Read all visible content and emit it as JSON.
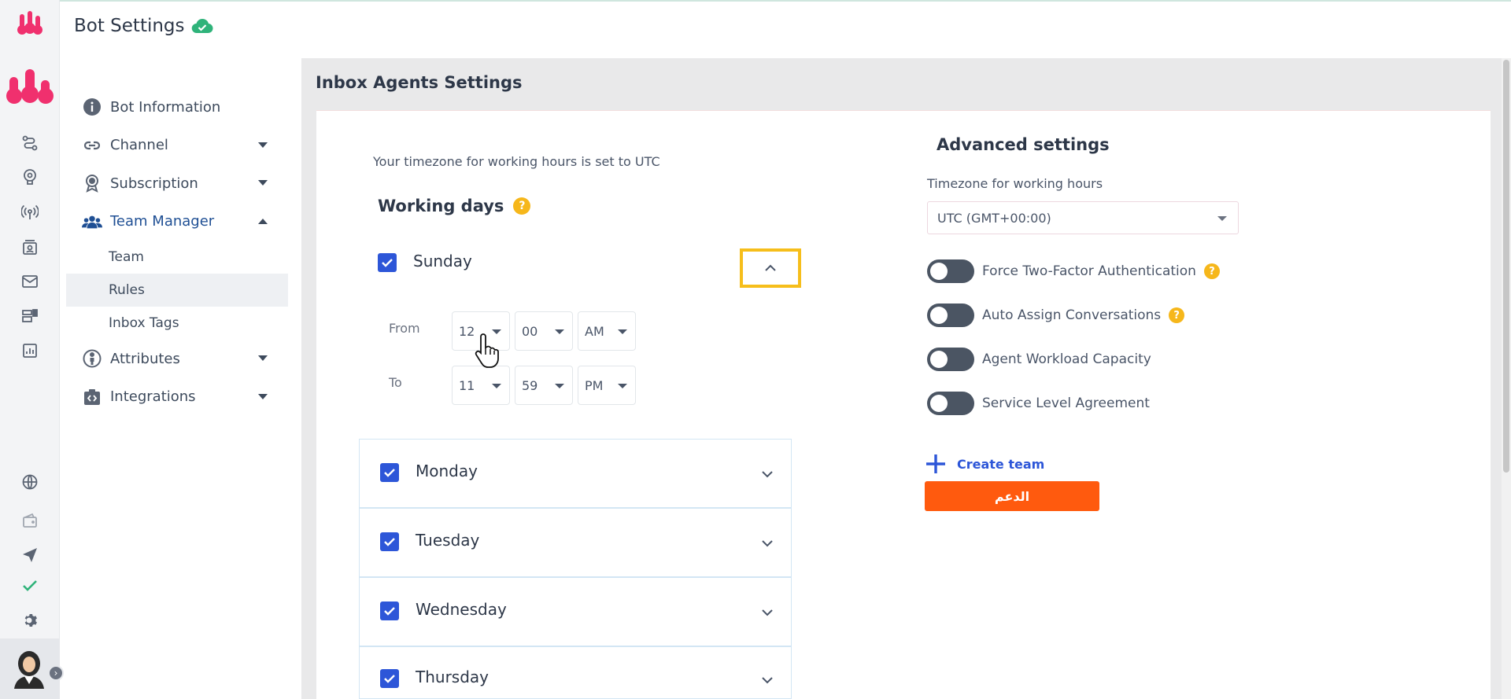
{
  "header": {
    "title": "Bot Settings",
    "status_icon": "cloud-check-icon",
    "status_color": "#2fb37a"
  },
  "rail": {
    "icons": [
      "route-icon",
      "brain-icon",
      "broadcast-icon",
      "contacts-icon",
      "mail-icon",
      "templates-icon",
      "analytics-icon",
      "globe-icon",
      "wallet-icon",
      "send-icon",
      "check-icon",
      "gear-icon"
    ],
    "brand_color": "#f0306e"
  },
  "sidebar": {
    "items": [
      {
        "label": "Bot Information",
        "icon": "info-icon"
      },
      {
        "label": "Channel",
        "icon": "link-icon"
      },
      {
        "label": "Subscription",
        "icon": "badge-icon"
      },
      {
        "label": "Team Manager",
        "icon": "team-icon"
      },
      {
        "label": "Attributes",
        "icon": "person-icon"
      },
      {
        "label": "Integrations",
        "icon": "plugin-icon"
      }
    ],
    "team_manager_sub": [
      "Team",
      "Rules",
      "Inbox Tags"
    ]
  },
  "main": {
    "title": "Inbox Agents Settings",
    "timezone_note": "Your timezone for working hours is set to UTC",
    "working_days_title": "Working days",
    "help_symbol": "?",
    "sunday": {
      "label": "Sunday",
      "from_label": "From",
      "to_label": "To",
      "from": {
        "hour": "12",
        "minute": "00",
        "period": "AM"
      },
      "to": {
        "hour": "11",
        "minute": "59",
        "period": "PM"
      }
    },
    "days": [
      "Monday",
      "Tuesday",
      "Wednesday",
      "Thursday"
    ]
  },
  "advanced": {
    "title": "Advanced settings",
    "timezone_label": "Timezone for working hours",
    "timezone_value": "UTC (GMT+00:00)",
    "toggles": [
      "Force Two-Factor Authentication",
      "Auto Assign Conversations",
      "Agent Workload Capacity",
      "Service Level Agreement"
    ],
    "create_team_label": "Create team",
    "support_label": "الدعم",
    "support_color": "#ff5a0e",
    "accent_color": "#2d56d8"
  }
}
